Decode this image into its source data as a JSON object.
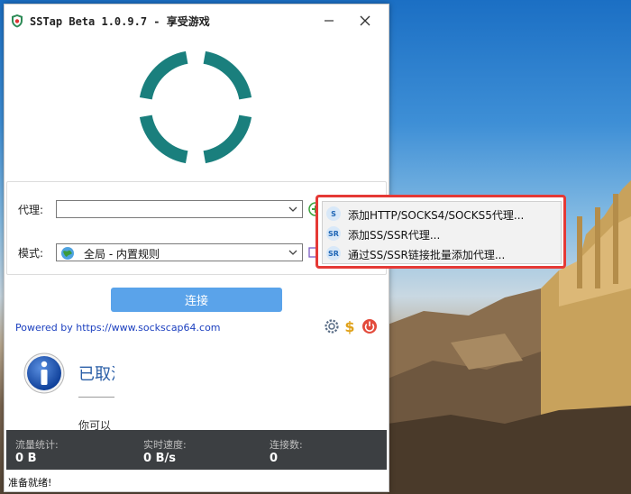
{
  "window": {
    "title": "SSTap Beta 1.0.9.7 - 享受游戏",
    "minimize_icon": "minimize-icon",
    "close_icon": "close-icon"
  },
  "proxy": {
    "label": "代理:",
    "value": ""
  },
  "mode": {
    "label": "模式:",
    "value": "全局 - 内置规则"
  },
  "context_menu": {
    "items": [
      {
        "icon": "S",
        "label": "添加HTTP/SOCKS4/SOCKS5代理..."
      },
      {
        "icon": "SR",
        "label": "添加SS/SSR代理..."
      },
      {
        "icon": "SR",
        "label": "通过SS/SSR链接批量添加代理..."
      }
    ]
  },
  "connect_button": "连接",
  "powered_by": "Powered by https://www.sockscap64.com",
  "status": {
    "title": "已取消",
    "description": "你可以"
  },
  "stats": {
    "traffic_label": "流量统计:",
    "traffic_value": "0 B",
    "speed_label": "实时速度:",
    "speed_value": "0 B/s",
    "conn_label": "连接数:",
    "conn_value": "0"
  },
  "statusbar": "准备就绪!",
  "colors": {
    "spinner": "#1a7f7d",
    "connect": "#5aa3ea",
    "menu_border": "#e53935",
    "stats_bg": "#3c3f42"
  }
}
